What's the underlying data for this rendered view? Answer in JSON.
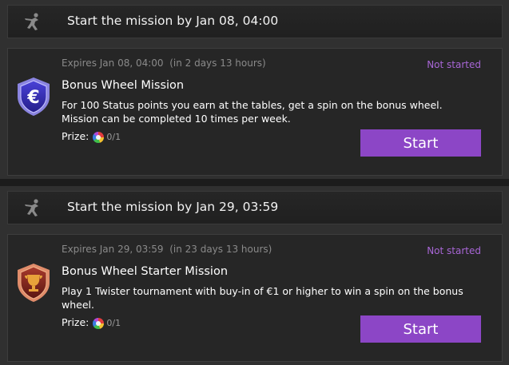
{
  "missions": [
    {
      "header": "Start the mission by Jan 08, 04:00",
      "expires": "Expires Jan 08, 04:00",
      "remaining": "(in 2 days 13 hours)",
      "status": "Not started",
      "title": "Bonus Wheel Mission",
      "description": "For 100 Status points you earn at the tables, get a spin on the bonus wheel. Mission can be completed 10 times per week.",
      "prize_label": "Prize:",
      "prize_count": "0/1",
      "button": "Start",
      "badge_icon": "euro-shield-icon",
      "badge_color": "#3a33b0"
    },
    {
      "header": "Start the mission by Jan 29, 03:59",
      "expires": "Expires Jan 29, 03:59",
      "remaining": "(in 23 days 13 hours)",
      "status": "Not started",
      "title": "Bonus Wheel Starter Mission",
      "description": "Play 1 Twister tournament with buy-in of €1 or higher to win a spin on the bonus wheel.",
      "prize_label": "Prize:",
      "prize_count": "0/1",
      "button": "Start",
      "badge_icon": "trophy-shield-icon",
      "badge_color": "#8a2a24"
    }
  ],
  "colors": {
    "accent": "#8c46c6",
    "status": "#a866d6"
  }
}
